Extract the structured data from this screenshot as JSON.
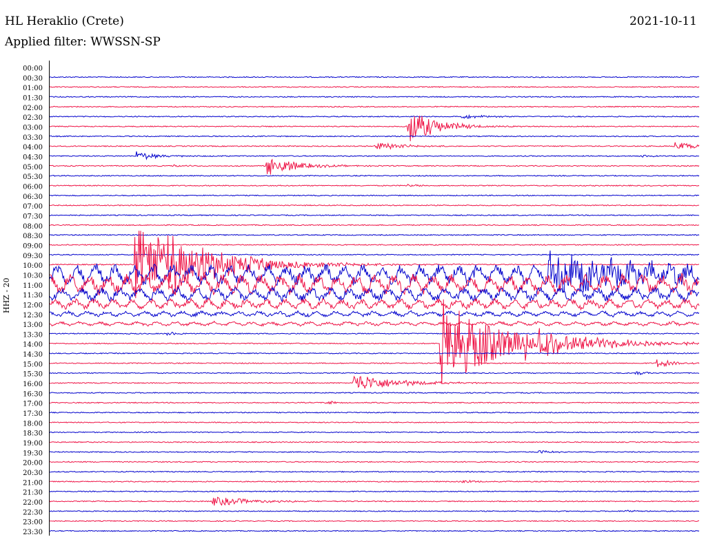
{
  "header": {
    "station": "HL Heraklio (Crete)",
    "date": "2021-10-11",
    "filter": "Applied filter: WWSSN-SP",
    "channel": "HHZ - 20"
  },
  "chart_data": {
    "type": "line",
    "title": "HL Heraklio (Crete)",
    "subtitle": "Applied filter: WWSSN-SP",
    "ylabel": "HHZ - 20",
    "ytick_labels": [
      "00:00",
      "00:30",
      "01:00",
      "01:30",
      "02:00",
      "02:30",
      "03:00",
      "03:30",
      "04:00",
      "04:30",
      "05:00",
      "05:30",
      "06:00",
      "06:30",
      "07:00",
      "07:30",
      "08:00",
      "08:30",
      "09:00",
      "09:30",
      "10:00",
      "10:30",
      "11:00",
      "11:30",
      "12:00",
      "12:30",
      "13:00",
      "13:30",
      "14:00",
      "14:30",
      "15:00",
      "15:30",
      "16:00",
      "16:30",
      "17:00",
      "17:30",
      "18:00",
      "18:30",
      "19:00",
      "19:30",
      "20:00",
      "20:30",
      "21:00",
      "21:30",
      "22:00",
      "22:30",
      "23:00",
      "23:30"
    ],
    "trace_colors": [
      "#0000cc",
      "#ee1144"
    ],
    "trace_minutes": 30,
    "events": [
      {
        "trace": "02:30",
        "minute": 16.5,
        "amp": 28,
        "duration": 2
      },
      {
        "trace": "02:00",
        "minute": 19.0,
        "amp": 3,
        "duration": 2
      },
      {
        "trace": "03:30",
        "minute": 15.0,
        "amp": 6,
        "duration": 2
      },
      {
        "trace": "03:30",
        "minute": 28.8,
        "amp": 6,
        "duration": 2
      },
      {
        "trace": "04:00",
        "minute": 4.0,
        "amp": 7,
        "duration": 1.5
      },
      {
        "trace": "04:00",
        "minute": 27.3,
        "amp": 2,
        "duration": 1
      },
      {
        "trace": "04:30",
        "minute": 5.7,
        "amp": 2,
        "duration": 1
      },
      {
        "trace": "04:30",
        "minute": 10.0,
        "amp": 16,
        "duration": 2
      },
      {
        "trace": "05:30",
        "minute": 16.5,
        "amp": 2,
        "duration": 1
      },
      {
        "trace": "10:00",
        "minute": 0.0,
        "amp": 30,
        "duration": 30,
        "continuous": true
      },
      {
        "trace": "10:30",
        "minute": 0.0,
        "amp": 30,
        "duration": 30,
        "continuous": true
      },
      {
        "trace": "11:00",
        "minute": 0.0,
        "amp": 20,
        "duration": 30,
        "continuous": true
      },
      {
        "trace": "11:30",
        "minute": 0.0,
        "amp": 15,
        "duration": 30,
        "continuous": true
      },
      {
        "trace": "09:30",
        "minute": 3.9,
        "amp": 60,
        "duration": 3
      },
      {
        "trace": "09:30",
        "minute": 5.0,
        "amp": 40,
        "duration": 5
      },
      {
        "trace": "10:00",
        "minute": 23.0,
        "amp": 30,
        "duration": 7
      },
      {
        "trace": "12:00",
        "minute": 0.0,
        "amp": 8,
        "duration": 30,
        "continuous": true
      },
      {
        "trace": "12:30",
        "minute": 0.0,
        "amp": 6,
        "duration": 30,
        "continuous": true
      },
      {
        "trace": "13:00",
        "minute": 5.4,
        "amp": 3,
        "duration": 1
      },
      {
        "trace": "13:30",
        "minute": 18.0,
        "amp": 70,
        "duration": 4
      },
      {
        "trace": "13:30",
        "minute": 21.8,
        "amp": 20,
        "duration": 5
      },
      {
        "trace": "14:30",
        "minute": 28.0,
        "amp": 6,
        "duration": 1.5
      },
      {
        "trace": "15:00",
        "minute": 27.0,
        "amp": 3,
        "duration": 1
      },
      {
        "trace": "15:30",
        "minute": 14.0,
        "amp": 14,
        "duration": 3
      },
      {
        "trace": "16:30",
        "minute": 12.7,
        "amp": 3,
        "duration": 1
      },
      {
        "trace": "19:00",
        "minute": 22.5,
        "amp": 3,
        "duration": 1
      },
      {
        "trace": "20:30",
        "minute": 19.0,
        "amp": 3,
        "duration": 1
      },
      {
        "trace": "21:30",
        "minute": 7.5,
        "amp": 7,
        "duration": 3
      },
      {
        "trace": "22:00",
        "minute": 26.5,
        "amp": 2,
        "duration": 1
      },
      {
        "trace": "23:30",
        "minute": 23.0,
        "amp": 7,
        "duration": 2
      }
    ]
  }
}
